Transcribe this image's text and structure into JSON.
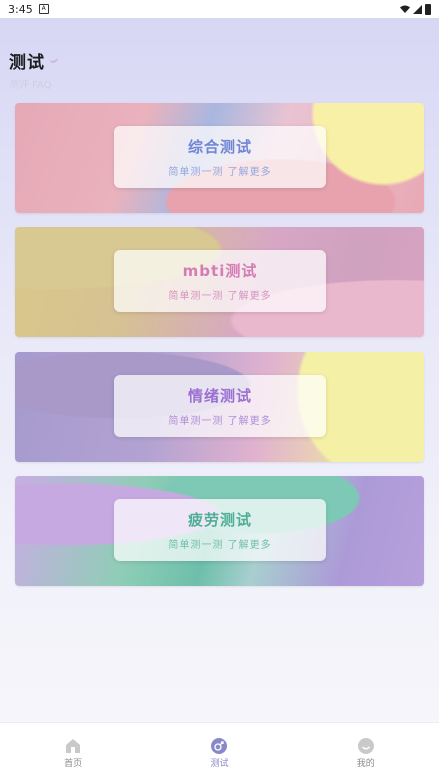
{
  "status_bar": {
    "time": "3:45",
    "sim_badge": "A"
  },
  "header": {
    "title": "测试",
    "subtitle": "测评 FAQ"
  },
  "cards": [
    {
      "title": "综合测试",
      "desc": "简单测一测 了解更多"
    },
    {
      "title": "mbti测试",
      "desc": "简单测一测 了解更多"
    },
    {
      "title": "情绪测试",
      "desc": "简单测一测 了解更多"
    },
    {
      "title": "疲劳测试",
      "desc": "简单测一测 了解更多"
    }
  ],
  "tabbar": {
    "active_color": "#8a89c8",
    "inactive_color": "#c9c9c9",
    "tabs": [
      {
        "label": "首页",
        "icon": "home-icon"
      },
      {
        "label": "测试",
        "icon": "test-icon"
      },
      {
        "label": "我的",
        "icon": "profile-icon"
      }
    ],
    "active_index": 1
  }
}
